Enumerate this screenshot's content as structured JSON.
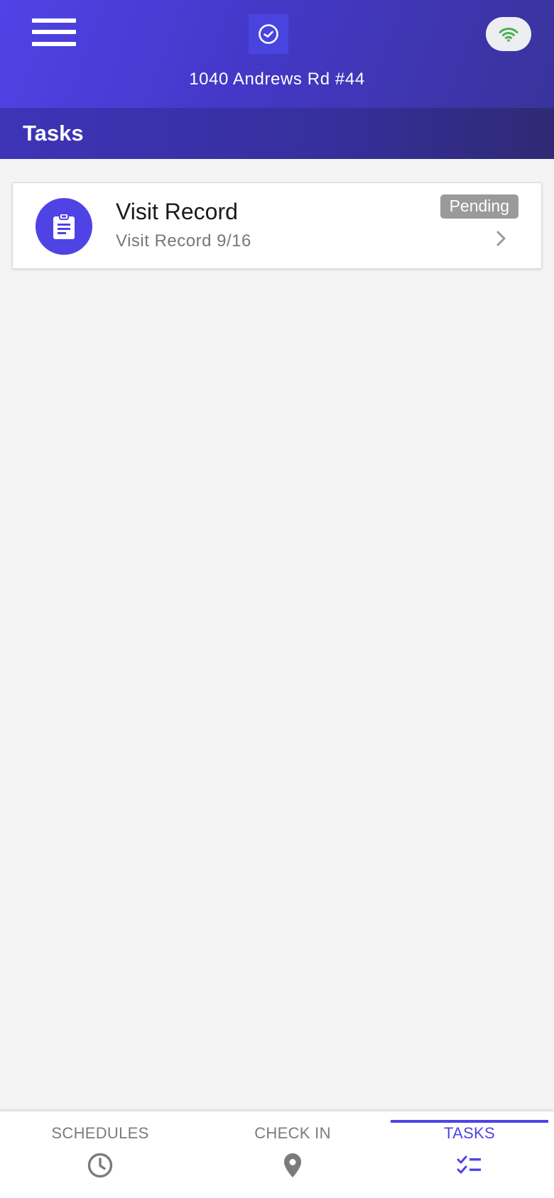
{
  "header": {
    "menu_icon": "hamburger-menu-icon",
    "logo_icon": "clock-icon",
    "connection_icon": "wifi-icon",
    "connection_color": "#4caf50",
    "address": "1040 Andrews Rd #44"
  },
  "page": {
    "title": "Tasks"
  },
  "tasks": [
    {
      "icon": "clipboard-icon",
      "title": "Visit Record",
      "subtitle": "Visit Record 9/16",
      "status": "Pending"
    }
  ],
  "bottom_nav": {
    "schedules": {
      "label": "SCHEDULES",
      "icon": "clock-icon"
    },
    "check_in": {
      "label": "CHECK IN",
      "icon": "location-pin-icon"
    },
    "tasks": {
      "label": "TASKS",
      "icon": "checklist-icon",
      "active": true
    }
  },
  "colors": {
    "accent": "#4f43e6",
    "header_start": "#4f43e6",
    "header_end": "#3a339c",
    "badge_pending": "#9a9a9a"
  }
}
